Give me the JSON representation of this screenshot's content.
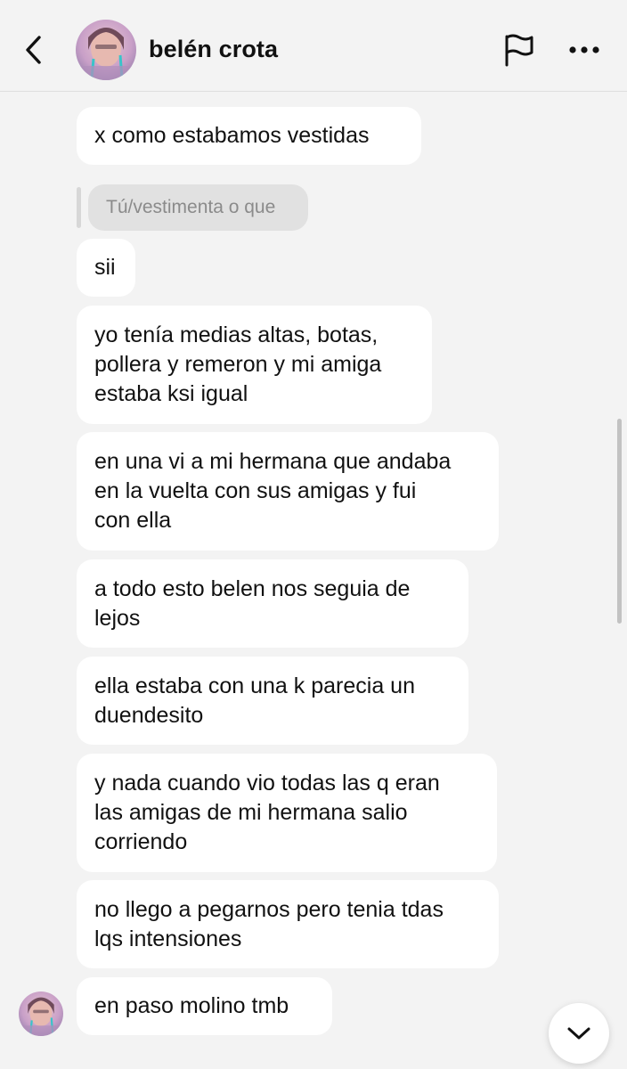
{
  "header": {
    "contact_name": "belén crota",
    "back_icon": "chevron-left-icon",
    "flag_icon": "flag-icon",
    "more_icon": "more-horizontal-icon"
  },
  "messages": [
    {
      "text": "x como estabamos vestidas"
    },
    {
      "reply_quote": "Tú/vestimenta o que"
    },
    {
      "text": "sii"
    },
    {
      "lines": [
        "yo tenía medias altas, botas,",
        "pollera y remeron y mi amiga",
        "estaba ksi igual"
      ]
    },
    {
      "lines": [
        "en una vi a mi hermana que andaba",
        "en la vuelta con sus amigas y fui",
        "con ella"
      ]
    },
    {
      "lines": [
        "a todo esto belen nos seguia de",
        "lejos"
      ]
    },
    {
      "lines": [
        "ella estaba con una k parecia un",
        "duendesito"
      ]
    },
    {
      "lines": [
        "y nada cuando vio todas las q eran",
        "las amigas de mi hermana salio",
        "corriendo"
      ]
    },
    {
      "lines": [
        "no llego a pegarnos pero tenia tdas",
        "lqs intensiones"
      ]
    },
    {
      "text": "en paso molino tmb"
    }
  ],
  "scroll_down_icon": "chevron-down-icon",
  "colors": {
    "background": "#f3f3f3",
    "bubble": "#ffffff",
    "reply_chip": "#e1e1e1",
    "reply_text": "#8b8b8b"
  }
}
